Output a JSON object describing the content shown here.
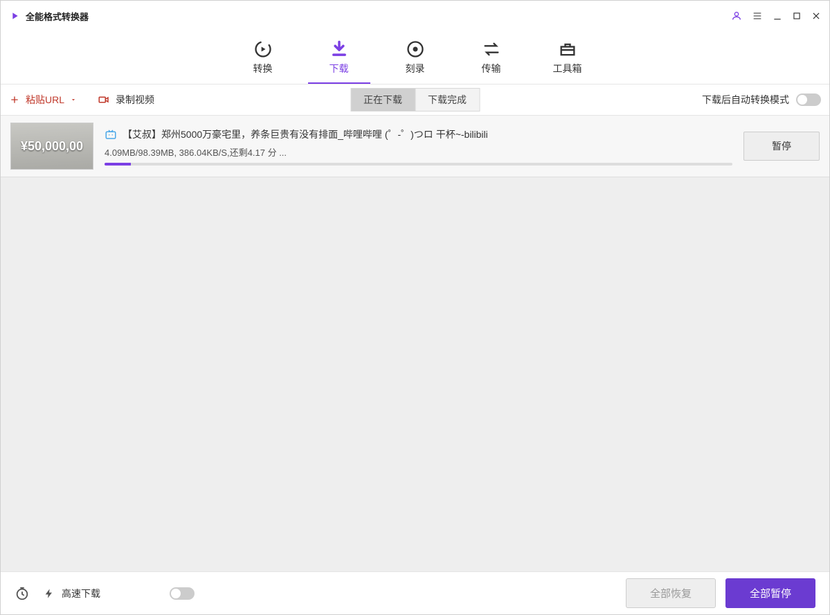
{
  "app": {
    "title": "全能格式转换器"
  },
  "tabs": [
    {
      "label": "转换"
    },
    {
      "label": "下载"
    },
    {
      "label": "刻录"
    },
    {
      "label": "传输"
    },
    {
      "label": "工具箱"
    }
  ],
  "toolbar": {
    "paste_url_label": "粘贴URL",
    "record_label": "录制视频",
    "sub_tabs": {
      "downloading": "正在下载",
      "completed": "下载完成"
    },
    "auto_convert_label": "下载后自动转换模式"
  },
  "download": {
    "thumbnail_text": "¥50,000,00",
    "title": "【艾叔】郑州5000万豪宅里，养条巨贵有没有排面_哔哩哔哩 (゜-゜)つロ 干杯~-bilibili",
    "status": "4.09MB/98.39MB, 386.04KB/S,还剩4.17 分 ...",
    "pause_label": "暂停"
  },
  "footer": {
    "high_speed_label": "高速下载",
    "resume_all_label": "全部恢复",
    "pause_all_label": "全部暂停"
  }
}
